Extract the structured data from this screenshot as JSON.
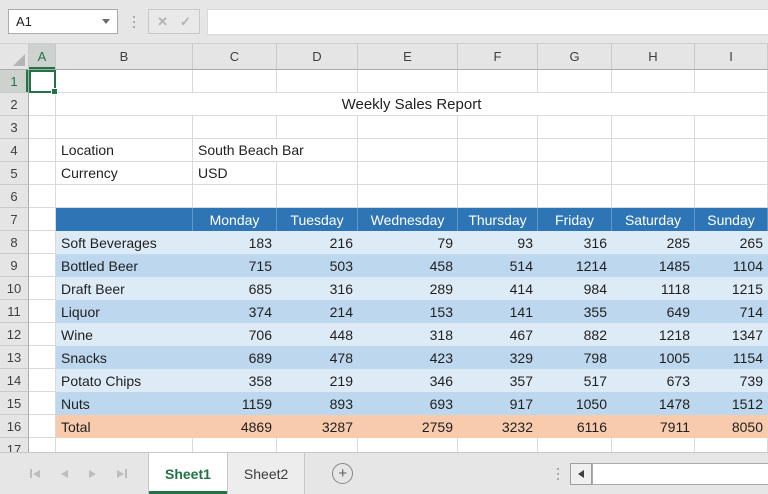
{
  "formula_row": {
    "name_box_value": "A1",
    "formula_value": "",
    "cancel_glyph": "✕",
    "enter_glyph": "✓"
  },
  "grid": {
    "column_headers": [
      "A",
      "B",
      "C",
      "D",
      "E",
      "F",
      "G",
      "H",
      "I"
    ],
    "row_numbers": [
      1,
      2,
      3,
      4,
      5,
      6,
      7,
      8,
      9,
      10,
      11,
      12,
      13,
      14,
      15,
      16,
      17
    ],
    "selected_cell": "A1",
    "selected_column": "A",
    "selected_row": 1
  },
  "sheet": {
    "title": "Weekly Sales Report",
    "title_row": 2,
    "info_rows": [
      {
        "row": 4,
        "label": "Location",
        "value": "South Beach Bar"
      },
      {
        "row": 5,
        "label": "Currency",
        "value": "USD"
      }
    ],
    "table": {
      "header_row": 7,
      "first_data_row": 8,
      "days": [
        "Monday",
        "Tuesday",
        "Wednesday",
        "Thursday",
        "Friday",
        "Saturday",
        "Sunday"
      ],
      "rows": [
        {
          "label": "Soft Beverages",
          "values": [
            183,
            216,
            79,
            93,
            316,
            285,
            265
          ]
        },
        {
          "label": "Bottled Beer",
          "values": [
            715,
            503,
            458,
            514,
            1214,
            1485,
            1104
          ]
        },
        {
          "label": "Draft Beer",
          "values": [
            685,
            316,
            289,
            414,
            984,
            1118,
            1215
          ]
        },
        {
          "label": "Liquor",
          "values": [
            374,
            214,
            153,
            141,
            355,
            649,
            714
          ]
        },
        {
          "label": "Wine",
          "values": [
            706,
            448,
            318,
            467,
            882,
            1218,
            1347
          ]
        },
        {
          "label": "Snacks",
          "values": [
            689,
            478,
            423,
            329,
            798,
            1005,
            1154
          ]
        },
        {
          "label": "Potato Chips",
          "values": [
            358,
            219,
            346,
            357,
            517,
            673,
            739
          ]
        },
        {
          "label": "Nuts",
          "values": [
            1159,
            893,
            693,
            917,
            1050,
            1478,
            1512
          ]
        }
      ],
      "total": {
        "row": 16,
        "label": "Total",
        "values": [
          4869,
          3287,
          2759,
          3232,
          6116,
          7911,
          8050
        ]
      }
    }
  },
  "tab_bar": {
    "tabs": [
      {
        "label": "Sheet1",
        "active": true
      },
      {
        "label": "Sheet2",
        "active": false
      }
    ],
    "add_glyph": "+",
    "nav_icons": [
      "first-sheet",
      "previous-sheet",
      "next-sheet",
      "last-sheet"
    ]
  },
  "colors": {
    "accent_green": "#217346",
    "header_blue": "#2E75B6",
    "band_light": "#DDEBF7",
    "band_medium": "#BDD7EE",
    "total_fill": "#F8CBAD",
    "chrome_gray": "#E6E6E6"
  }
}
